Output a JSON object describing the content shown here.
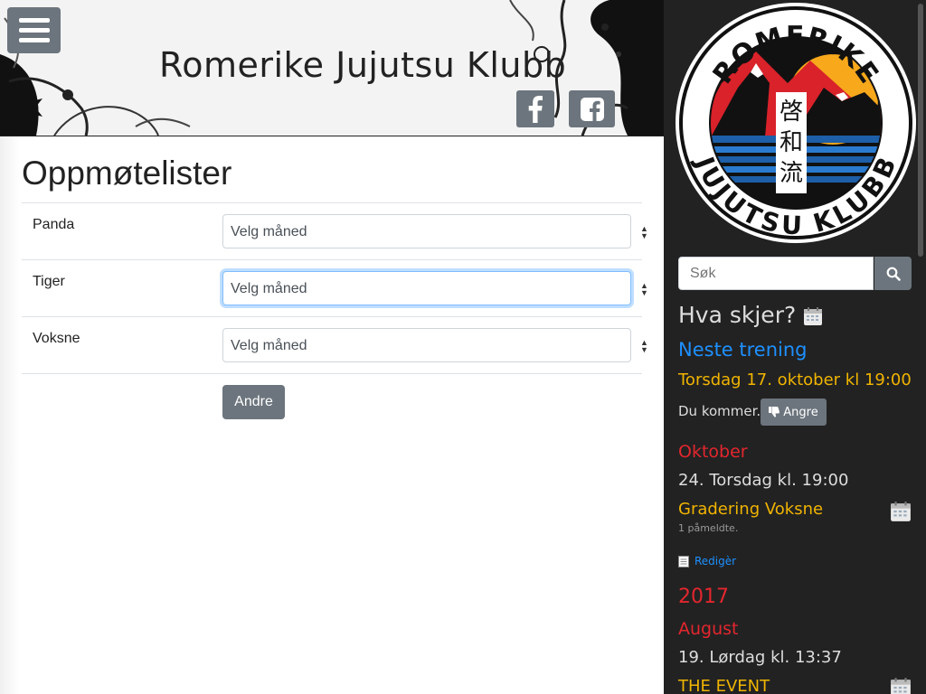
{
  "header": {
    "site_title": "Romerike Jujutsu Klubb",
    "menu_icon": "hamburger-icon",
    "social": [
      {
        "name": "facebook-icon"
      },
      {
        "name": "facebook-square-icon"
      }
    ]
  },
  "main": {
    "page_title": "Oppmøtelister",
    "groups": [
      {
        "label": "Panda",
        "select_value": "Velg måned"
      },
      {
        "label": "Tiger",
        "select_value": "Velg måned"
      },
      {
        "label": "Voksne",
        "select_value": "Velg måned"
      }
    ],
    "other_button": "Andre"
  },
  "sidebar": {
    "logo": {
      "top_text": "ROMERIKE",
      "bottom_text": "JUJUTSU KLUBB",
      "kanji": [
        "啓",
        "和",
        "流"
      ]
    },
    "search_placeholder": "Søk",
    "heading": "Hva skjer?",
    "next_training_title": "Neste trening",
    "next_training_date": "Torsdag 17. oktober kl 19:00",
    "attendance_text": "Du kommer.",
    "undo_button": "Angre",
    "events": [
      {
        "month": "Oktober",
        "time": "24. Torsdag kl. 19:00",
        "name": "Gradering Voksne",
        "signups": "1 påmeldte.",
        "edit": "Redigèr"
      }
    ],
    "year": "2017",
    "events_2017": [
      {
        "month": "August",
        "time": "19. Lørdag kl. 13:37",
        "name": "THE EVENT"
      }
    ],
    "colors": {
      "accent_blue": "#1e90ff",
      "accent_yellow": "#f0b400",
      "accent_red": "#e3262e",
      "bg": "#222222"
    }
  }
}
